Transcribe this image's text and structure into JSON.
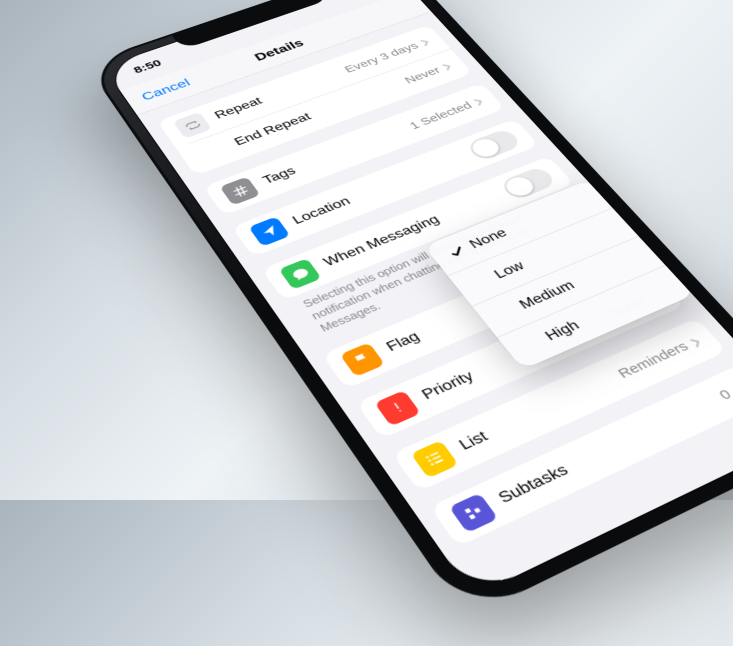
{
  "status": {
    "time": "8:50"
  },
  "nav": {
    "cancel": "Cancel",
    "title": "Details"
  },
  "rows": {
    "repeat": {
      "label": "Repeat",
      "value": "Every 3 days"
    },
    "end_repeat": {
      "label": "End Repeat",
      "value": "Never"
    },
    "tags": {
      "label": "Tags",
      "value": "1 Selected"
    },
    "location": {
      "label": "Location"
    },
    "messaging": {
      "label": "When Messaging"
    },
    "flag": {
      "label": "Flag"
    },
    "priority": {
      "label": "Priority",
      "value": "None"
    },
    "list": {
      "label": "List",
      "value": "Reminders"
    },
    "subtasks": {
      "label": "Subtasks",
      "value": "0"
    }
  },
  "footnote": "Selecting this option will show the reminder notification when chatting with a person in Messages.",
  "popup": {
    "options": [
      "None",
      "Low",
      "Medium",
      "High"
    ],
    "selected": "None"
  }
}
